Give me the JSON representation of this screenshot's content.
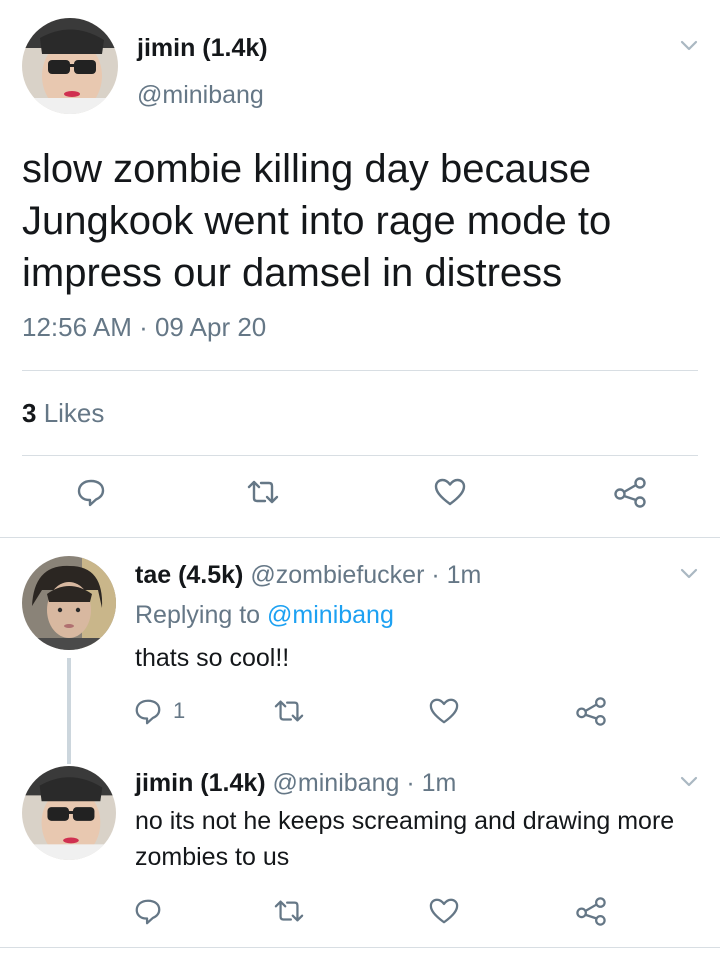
{
  "main_tweet": {
    "name": "jimin (1.4k)",
    "handle": "@minibang",
    "text": "slow zombie killing day because Jungkook went into rage mode to impress our damsel in distress",
    "timestamp": "12:56 AM · 09 Apr 20",
    "likes_count": "3",
    "likes_label": " Likes",
    "actions": [
      "reply-icon",
      "retweet-icon",
      "like-icon",
      "share-icon"
    ]
  },
  "replies": [
    {
      "name": "tae (4.5k)",
      "handle": "@zombiefucker",
      "time": " · 1m",
      "replying_prefix": "Replying to ",
      "replying_mention": "@minibang",
      "text": "thats so cool!!",
      "reply_count": "1"
    },
    {
      "name": "jimin (1.4k)",
      "handle": "@minibang",
      "time": " · 1m",
      "text": "no its not he keeps screaming and drawing more zombies to us",
      "reply_count": ""
    }
  ],
  "colors": {
    "text": "#14171a",
    "secondary": "#657786",
    "link": "#1da1f2",
    "divider": "#d8dee3"
  }
}
